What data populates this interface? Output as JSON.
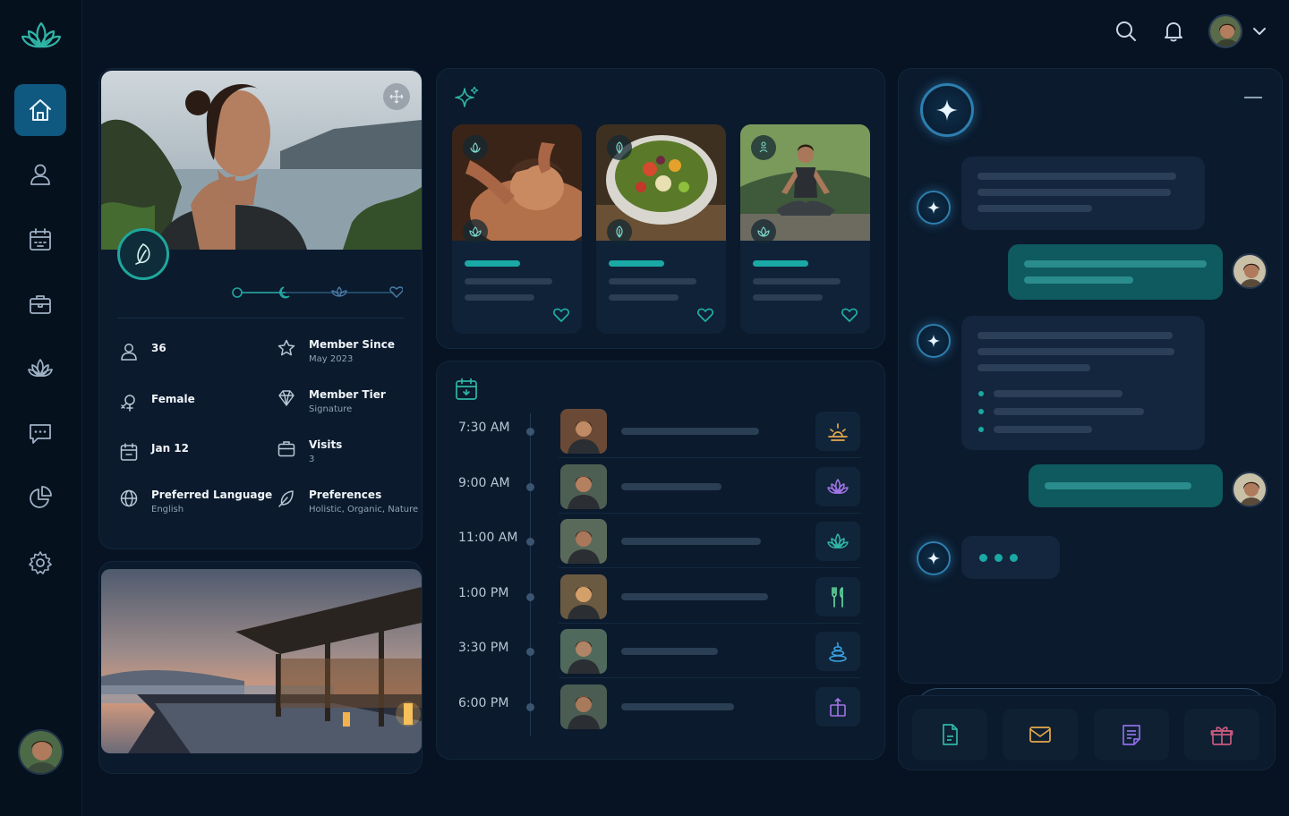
{
  "nav": {
    "items": [
      {
        "name": "home",
        "icon": "home-icon"
      },
      {
        "name": "profile",
        "icon": "user-icon"
      },
      {
        "name": "calendar",
        "icon": "calendar-icon"
      },
      {
        "name": "bookings",
        "icon": "briefcase-icon"
      },
      {
        "name": "wellness",
        "icon": "lotus-icon"
      },
      {
        "name": "messages",
        "icon": "chat-icon"
      },
      {
        "name": "analytics",
        "icon": "pie-chart-icon"
      },
      {
        "name": "settings",
        "icon": "gear-icon"
      }
    ],
    "active": "home"
  },
  "profile": {
    "age": "36",
    "gender": "Female",
    "birthday": "Jan 12",
    "language_label": "Preferred Language",
    "language_value": "English",
    "member_since_label": "Member Since",
    "member_since_value": "May 2023",
    "tier_label": "Member Tier",
    "tier_value": "Signature",
    "visits_label": "Visits",
    "visits_value": "3",
    "preferences_label": "Preferences",
    "preferences_value": "Holistic, Organic, Nature"
  },
  "schedule": [
    {
      "time": "7:30 AM",
      "icon": "sunrise-icon",
      "color": "#e6a94a"
    },
    {
      "time": "9:00 AM",
      "icon": "lotus-icon",
      "color": "#a274e6"
    },
    {
      "time": "11:00 AM",
      "icon": "lotus-icon",
      "color": "#2fb5a6"
    },
    {
      "time": "1:00 PM",
      "icon": "utensils-icon",
      "color": "#5fd49a"
    },
    {
      "time": "3:30 PM",
      "icon": "spa-stones-icon",
      "color": "#3aa0e0"
    },
    {
      "time": "6:00 PM",
      "icon": "gift-box-icon",
      "color": "#a274e6"
    }
  ],
  "colors": {
    "accent": "#1aa9a4",
    "primary": "#0f5880",
    "background": "#071322"
  }
}
